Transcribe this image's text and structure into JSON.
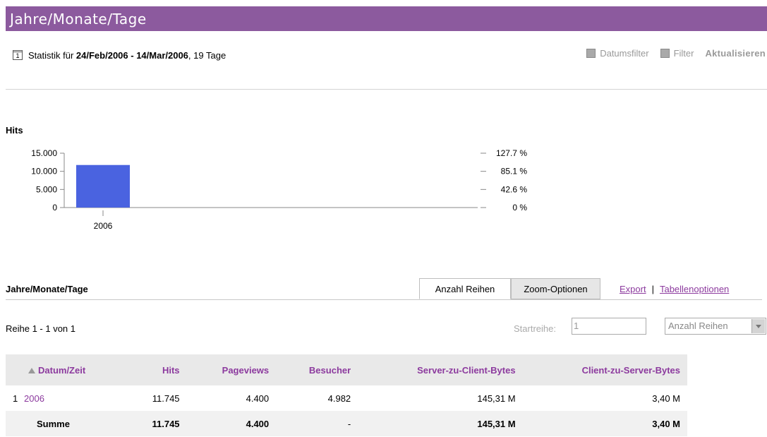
{
  "header": {
    "title": "Jahre/Monate/Tage"
  },
  "stats": {
    "prefix": "Statistik für",
    "range": "24/Feb/2006 - 14/Mar/2006",
    "suffix": ", 19 Tage",
    "calendar_day": "1"
  },
  "toolbar": {
    "date_filter_label": "Datumsfilter",
    "filter_label": "Filter",
    "refresh_label": "Aktualisieren"
  },
  "chart_title": "Hits",
  "chart_data": {
    "type": "bar",
    "categories": [
      "2006"
    ],
    "values": [
      11745
    ],
    "ylim": [
      0,
      15000
    ],
    "y_ticks": [
      "15.000",
      "10.000",
      "5.000",
      "0"
    ],
    "y_tick_values": [
      15000,
      10000,
      5000,
      0
    ],
    "y2_ticks": [
      "127.7 %",
      "85.1 %",
      "42.6 %",
      "0 %"
    ],
    "bar_color": "#4a63e0"
  },
  "table_section": {
    "title": "Jahre/Monate/Tage",
    "tabs": [
      "Anzahl Reihen",
      "Zoom-Optionen"
    ],
    "links": [
      "Export",
      "Tabellenoptionen"
    ],
    "separator": "|",
    "row_info": "Reihe 1 - 1 von 1",
    "start_row_label": "Startreihe:",
    "start_row_value": "1",
    "rows_select_value": "Anzahl Reihen"
  },
  "table": {
    "columns": [
      "Datum/Zeit",
      "Hits",
      "Pageviews",
      "Besucher",
      "Server-zu-Client-Bytes",
      "Client-zu-Server-Bytes"
    ],
    "rows": [
      {
        "index": "1",
        "date": "2006",
        "hits": "11.745",
        "pageviews": "4.400",
        "visitors": "4.982",
        "s2c": "145,31 M",
        "c2s": "3,40 M"
      }
    ],
    "total": {
      "label": "Summe",
      "hits": "11.745",
      "pageviews": "4.400",
      "visitors": "-",
      "s2c": "145,31 M",
      "c2s": "3,40 M"
    }
  },
  "colors": {
    "header_bg": "#8c5a9e",
    "link": "#8c3a9e"
  }
}
